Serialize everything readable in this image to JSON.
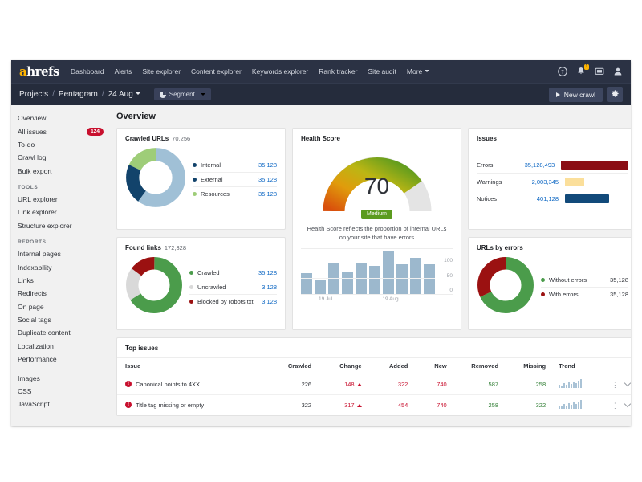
{
  "topnav": {
    "logo": "ahrefs",
    "logo_first": "a",
    "logo_rest": "hrefs",
    "items": [
      {
        "label": "Dashboard",
        "caret": false
      },
      {
        "label": "Alerts",
        "caret": false
      },
      {
        "label": "Site explorer",
        "caret": false
      },
      {
        "label": "Content explorer",
        "caret": false
      },
      {
        "label": "Keywords explorer",
        "caret": false
      },
      {
        "label": "Rank tracker",
        "caret": false
      },
      {
        "label": "Site audit",
        "caret": false
      },
      {
        "label": "More",
        "caret": true
      }
    ],
    "icons": [
      "help-icon",
      "notifications-bell-icon",
      "messages-icon",
      "user-account-icon"
    ],
    "bell_badge": "1"
  },
  "breadcrumb": {
    "items": [
      "Projects",
      "Pentagram",
      "24 Aug"
    ],
    "separator": "/",
    "date_has_caret": true,
    "segment_label": "Segment",
    "new_crawl_label": "New crawl",
    "settings_icon": "gear-icon"
  },
  "sidebar": {
    "items": [
      {
        "label": "Overview",
        "badge": null
      },
      {
        "label": "All issues",
        "badge": "124"
      },
      {
        "label": "To-do",
        "badge": null
      },
      {
        "label": "Crawl log",
        "badge": null
      },
      {
        "label": "Bulk export",
        "badge": null
      }
    ],
    "tools_heading": "TOOLS",
    "tools": [
      {
        "label": "URL explorer"
      },
      {
        "label": "Link explorer"
      },
      {
        "label": "Structure explorer"
      }
    ],
    "reports_heading": "REPORTS",
    "reports": [
      {
        "label": "Internal pages"
      },
      {
        "label": "Indexability"
      },
      {
        "label": "Links"
      },
      {
        "label": "Redirects"
      },
      {
        "label": "On page"
      },
      {
        "label": "Social tags"
      },
      {
        "label": "Duplicate content"
      },
      {
        "label": "Localization"
      },
      {
        "label": "Performance"
      }
    ],
    "assets": [
      {
        "label": "Images"
      },
      {
        "label": "CSS"
      },
      {
        "label": "JavaScript"
      }
    ]
  },
  "page": {
    "title": "Overview"
  },
  "cards": {
    "crawled_urls": {
      "title": "Crawled URLs",
      "subtitle": "70,256",
      "legend": [
        {
          "label": "Internal",
          "value": "35,128",
          "color": "#12436b"
        },
        {
          "label": "External",
          "value": "35,128",
          "color": "#12436b"
        },
        {
          "label": "Resources",
          "value": "35,128",
          "color": "#9ecd78"
        }
      ]
    },
    "found_links": {
      "title": "Found links",
      "subtitle": "172,328",
      "legend": [
        {
          "label": "Crawled",
          "value": "35,128",
          "color": "#4b9c4b"
        },
        {
          "label": "Uncrawled",
          "value": "3,128",
          "color": "#d9d9d9"
        },
        {
          "label": "Blocked by robots.txt",
          "value": "3,128",
          "color": "#9b1111"
        }
      ]
    },
    "health_score": {
      "title": "Health Score",
      "value": "70",
      "grade": "Medium",
      "grade_color": "#5b9b1e",
      "note": "Health Score reflects the proportion of internal URLs on your site that have errors"
    },
    "issues": {
      "title": "Issues",
      "rows": [
        {
          "label": "Errors",
          "value": "35,128,493",
          "color": "#8b0d14"
        },
        {
          "label": "Warnings",
          "value": "2,003,345",
          "color": "#fbdf9b"
        },
        {
          "label": "Notices",
          "value": "401,128",
          "color": "#124a7a"
        }
      ]
    },
    "urls_by_errors": {
      "title": "URLs by errors",
      "legend": [
        {
          "label": "Without errors",
          "value": "35,128",
          "color": "#4b9c4b"
        },
        {
          "label": "With errors",
          "value": "35,128",
          "color": "#9b1111"
        }
      ]
    }
  },
  "chart_data": [
    {
      "type": "pie",
      "name": "Crawled URLs",
      "title": "Crawled URLs",
      "total": "70,256",
      "labels": [
        "Internal",
        "External",
        "Resources"
      ],
      "values": [
        35128,
        35128,
        35128
      ],
      "display_fractions": [
        0.6,
        0.22,
        0.18
      ],
      "colors": [
        "#a0c0d6",
        "#12436b",
        "#9ecd78"
      ],
      "legend": "right"
    },
    {
      "type": "pie",
      "name": "Found links",
      "title": "Found links",
      "total": "172,328",
      "labels": [
        "Crawled",
        "Uncrawled",
        "Blocked by robots.txt"
      ],
      "values": [
        35128,
        3128,
        3128
      ],
      "display_fractions": [
        0.66,
        0.19,
        0.15
      ],
      "colors": [
        "#4b9c4b",
        "#d9d9d9",
        "#9b1111"
      ],
      "legend": "right"
    },
    {
      "type": "bar",
      "name": "Health Score gauge",
      "title": "Health Score",
      "value": 70,
      "ylim": [
        0,
        100
      ],
      "grade": "Medium"
    },
    {
      "type": "bar",
      "name": "Health Score history",
      "title": "",
      "categories": [
        "",
        "",
        "19 Jul",
        "",
        "",
        "",
        "",
        "19 Aug",
        "",
        "",
        ""
      ],
      "values": [
        48,
        34,
        76,
        53,
        78,
        70,
        106,
        74,
        90,
        0,
        74
      ],
      "xlabel": "",
      "ylabel": "",
      "ylim": [
        0,
        120
      ],
      "ytick_labels": [
        "100",
        "50",
        "0"
      ],
      "xtick_labels": [
        "19 Jul",
        "19 Aug"
      ],
      "grid": true,
      "color": "#9cb8cd"
    },
    {
      "type": "bar",
      "name": "Issues",
      "title": "Issues",
      "categories": [
        "Errors",
        "Warnings",
        "Notices"
      ],
      "values": [
        35128493,
        2003345,
        401128
      ],
      "display_fractions": [
        1.0,
        0.27,
        0.62
      ],
      "colors": [
        "#8b0d14",
        "#fbdf9b",
        "#124a7a"
      ],
      "xlabel": "",
      "ylabel": ""
    },
    {
      "type": "pie",
      "name": "URLs by errors",
      "title": "URLs by errors",
      "labels": [
        "Without errors",
        "With errors"
      ],
      "values": [
        35128,
        35128
      ],
      "display_fractions": [
        0.68,
        0.32
      ],
      "colors": [
        "#4b9c4b",
        "#9b1111"
      ],
      "legend": "right"
    }
  ],
  "top_issues": {
    "title": "Top issues",
    "columns": [
      "Issue",
      "Crawled",
      "Change",
      "Added",
      "New",
      "Removed",
      "Missing",
      "Trend",
      ""
    ],
    "rows": [
      {
        "issue": "Canonical points to 4XX",
        "crawled": "226",
        "change": "148",
        "change_dir": "up",
        "added": "322",
        "new": "740",
        "removed": "587",
        "missing": "258",
        "trend": [
          4,
          3,
          6,
          4,
          7,
          5,
          8,
          6,
          9,
          11
        ]
      },
      {
        "issue": "Title tag missing or empty",
        "crawled": "322",
        "change": "317",
        "change_dir": "up",
        "added": "454",
        "new": "740",
        "removed": "258",
        "missing": "322",
        "trend": [
          4,
          3,
          6,
          4,
          7,
          5,
          8,
          6,
          9,
          11
        ]
      }
    ]
  }
}
